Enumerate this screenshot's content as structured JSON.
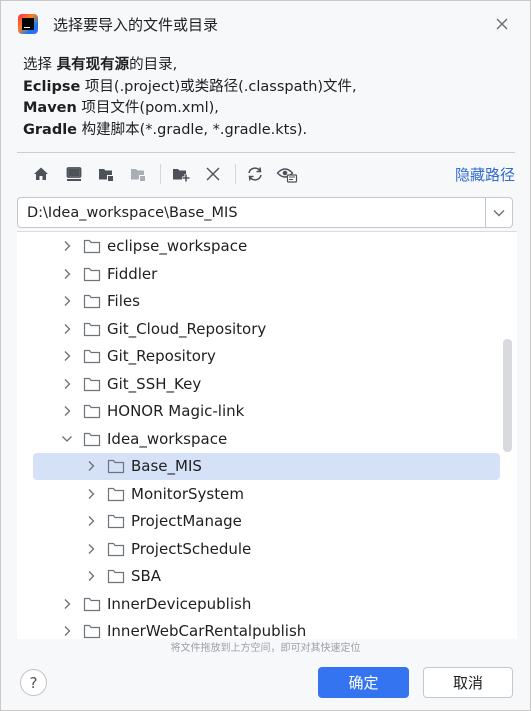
{
  "dialog": {
    "title": "选择要导入的文件或目录",
    "close_icon": "close-icon",
    "app_icon": "intellij-idea-logo"
  },
  "description": {
    "line1_prefix": "选择 ",
    "line1_bold": "具有现有源",
    "line1_suffix": "的目录,",
    "line2_bold": "Eclipse",
    "line2_rest": " 项目(.project)或类路径(.classpath)文件,",
    "line3_bold": "Maven",
    "line3_rest": " 项目文件(pom.xml),",
    "line4_bold": "Gradle",
    "line4_rest": " 构建脚本(*.gradle, *.gradle.kts)."
  },
  "toolbar": {
    "buttons": [
      {
        "name": "home-icon"
      },
      {
        "name": "desktop-icon"
      },
      {
        "name": "project-folder-icon"
      },
      {
        "name": "module-folder-icon"
      },
      {
        "name": "new-folder-icon"
      },
      {
        "name": "delete-icon"
      },
      {
        "name": "refresh-icon"
      },
      {
        "name": "show-hidden-files-icon"
      }
    ],
    "hide_path_label": "隐藏路径"
  },
  "path": {
    "value": "D:\\Idea_workspace\\Base_MIS",
    "dropdown_icon": "chevron-down-icon"
  },
  "tree": {
    "rows": [
      {
        "label": "eclipse_workspace",
        "level": 0,
        "expanded": false,
        "selected": false
      },
      {
        "label": "Fiddler",
        "level": 0,
        "expanded": false,
        "selected": false
      },
      {
        "label": "Files",
        "level": 0,
        "expanded": false,
        "selected": false
      },
      {
        "label": "Git_Cloud_Repository",
        "level": 0,
        "expanded": false,
        "selected": false
      },
      {
        "label": "Git_Repository",
        "level": 0,
        "expanded": false,
        "selected": false
      },
      {
        "label": "Git_SSH_Key",
        "level": 0,
        "expanded": false,
        "selected": false
      },
      {
        "label": "HONOR Magic-link",
        "level": 0,
        "expanded": false,
        "selected": false
      },
      {
        "label": "Idea_workspace",
        "level": 0,
        "expanded": true,
        "selected": false
      },
      {
        "label": "Base_MIS",
        "level": 1,
        "expanded": false,
        "selected": true
      },
      {
        "label": "MonitorSystem",
        "level": 1,
        "expanded": false,
        "selected": false
      },
      {
        "label": "ProjectManage",
        "level": 1,
        "expanded": false,
        "selected": false
      },
      {
        "label": "ProjectSchedule",
        "level": 1,
        "expanded": false,
        "selected": false
      },
      {
        "label": "SBA",
        "level": 1,
        "expanded": false,
        "selected": false
      },
      {
        "label": "InnerDevicepublish",
        "level": 0,
        "expanded": false,
        "selected": false
      },
      {
        "label": "InnerWebCarRentalpublish",
        "level": 0,
        "expanded": false,
        "selected": false
      }
    ]
  },
  "hint": "将文件拖放到上方空间，即可对其快速定位",
  "buttons": {
    "help_label": "?",
    "ok_label": "确定",
    "cancel_label": "取消"
  },
  "colors": {
    "accent": "#3574f0",
    "link": "#2f6bd1",
    "selection": "#d5e1f7"
  }
}
